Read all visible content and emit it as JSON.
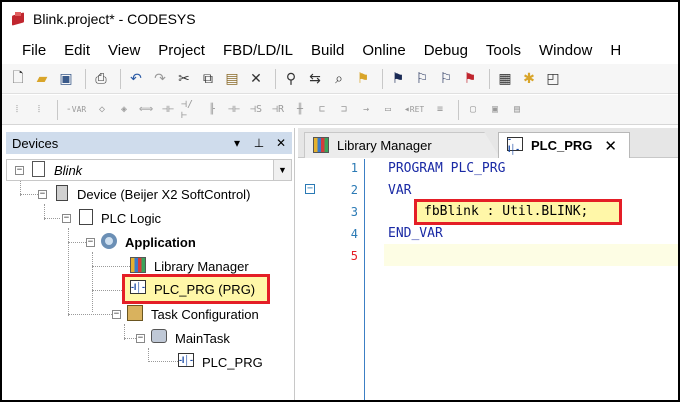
{
  "window": {
    "title": "Blink.project* - CODESYS"
  },
  "menu": {
    "items": [
      "File",
      "Edit",
      "View",
      "Project",
      "FBD/LD/IL",
      "Build",
      "Online",
      "Debug",
      "Tools",
      "Window",
      "H"
    ]
  },
  "toolbar1": {
    "icons": [
      "new-file-icon",
      "open-folder-icon",
      "save-icon",
      "print-icon",
      "undo-icon",
      "redo-icon",
      "cut-icon",
      "copy-icon",
      "paste-icon",
      "delete-icon",
      "find-icon",
      "replace-icon",
      "find-all-icon",
      "bookmark-icon",
      "next-bookmark-icon",
      "prev-bookmark-icon",
      "clear-bookmarks-icon",
      "project-icon",
      "add-object-icon",
      "window-icon"
    ]
  },
  "toolbar2": {
    "labels": [
      "VAR",
      "RET"
    ]
  },
  "devices_panel": {
    "title": "Devices",
    "pin_glyph": "↓",
    "close_glyph": "✕",
    "tree": [
      {
        "label": "Blink",
        "icon": "project-page-icon"
      },
      {
        "label": "Device (Beijer X2 SoftControl)",
        "icon": "device-icon"
      },
      {
        "label": "PLC Logic",
        "icon": "plc-logic-icon"
      },
      {
        "label": "Application",
        "icon": "gear-icon"
      },
      {
        "label": "Library Manager",
        "icon": "library-books-icon"
      },
      {
        "label": "PLC_PRG (PRG)",
        "icon": "program-icon"
      },
      {
        "label": "Task Configuration",
        "icon": "task-config-icon"
      },
      {
        "label": "MainTask",
        "icon": "maintask-icon"
      },
      {
        "label": "PLC_PRG",
        "icon": "program-icon"
      }
    ]
  },
  "editor": {
    "tabs": [
      {
        "label": "Library Manager",
        "icon": "library-books-icon",
        "active": false
      },
      {
        "label": "PLC_PRG",
        "icon": "program-icon",
        "active": true,
        "close": "✕"
      }
    ],
    "lines": [
      {
        "num": "1",
        "text": "PROGRAM PLC_PRG"
      },
      {
        "num": "2",
        "text": "VAR"
      },
      {
        "num": "3",
        "text": "fbBlink : Util.BLINK;"
      },
      {
        "num": "4",
        "text": "END_VAR"
      },
      {
        "num": "5",
        "text": ""
      }
    ],
    "fold_glyph": "−",
    "prg_icon_text": "-I│-"
  },
  "colors": {
    "highlight": "#e41e26",
    "keyword": "#1a2aa5",
    "line_number": "#2b7ab5",
    "panel_header": "#cfdcec"
  }
}
